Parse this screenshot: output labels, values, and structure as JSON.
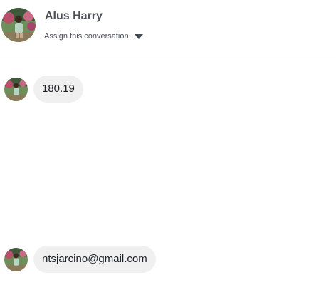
{
  "header": {
    "contact_name": "Alus Harry",
    "assign_label": "Assign this conversation",
    "assign_icon": "caret-down-icon"
  },
  "messages": [
    {
      "text": "180.19"
    },
    {
      "text": "ntsjarcino@gmail.com"
    }
  ],
  "colors": {
    "bubble": "#f1f0f0",
    "divider": "#dadde1",
    "name_text": "#4b4f56"
  }
}
